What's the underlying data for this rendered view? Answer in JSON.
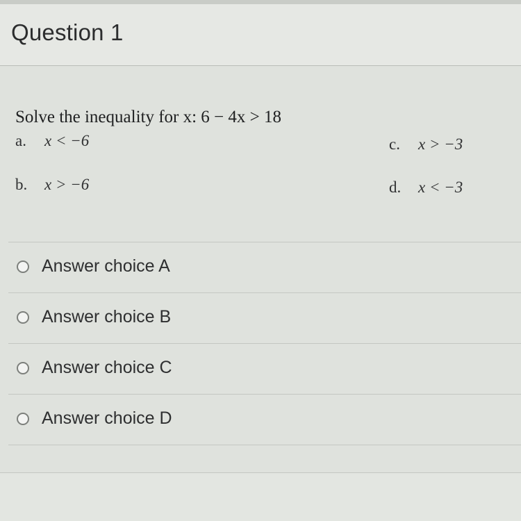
{
  "question": {
    "title": "Question 1",
    "stem": "Solve the inequality for x: 6 − 4x > 18",
    "options": [
      {
        "letter": "a.",
        "expr": "x < −6"
      },
      {
        "letter": "b.",
        "expr": "x > −6"
      },
      {
        "letter": "c.",
        "expr": "x > −3"
      },
      {
        "letter": "d.",
        "expr": "x < −3"
      }
    ]
  },
  "answers": [
    {
      "label": "Answer choice A"
    },
    {
      "label": "Answer choice B"
    },
    {
      "label": "Answer choice C"
    },
    {
      "label": "Answer choice D"
    }
  ]
}
